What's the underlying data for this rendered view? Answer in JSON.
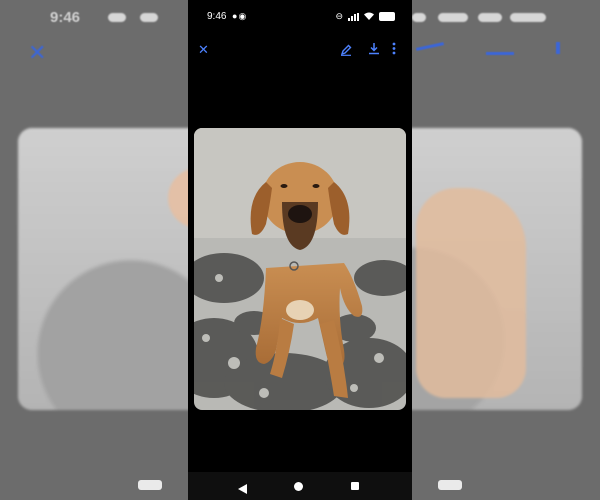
{
  "status_bar": {
    "time": "9:46",
    "notification_icons": [
      "chat-bubble-icon",
      "sync-icon"
    ],
    "system_icons": [
      "do-not-disturb-icon",
      "signal-icon",
      "wifi-icon",
      "battery-icon"
    ]
  },
  "viewer_toolbar": {
    "close_icon": "close-icon",
    "actions": [
      "edit-icon",
      "download-icon",
      "more-vert-icon"
    ]
  },
  "colors": {
    "accent": "#4d82ff",
    "screen_background": "#000000",
    "scrim": "#6c6c6c",
    "dog_fur": "#c58a4b",
    "ground": "#9a9a9a"
  },
  "navigation_bar": {
    "buttons": [
      "back-icon",
      "home-icon",
      "recents-icon"
    ]
  }
}
